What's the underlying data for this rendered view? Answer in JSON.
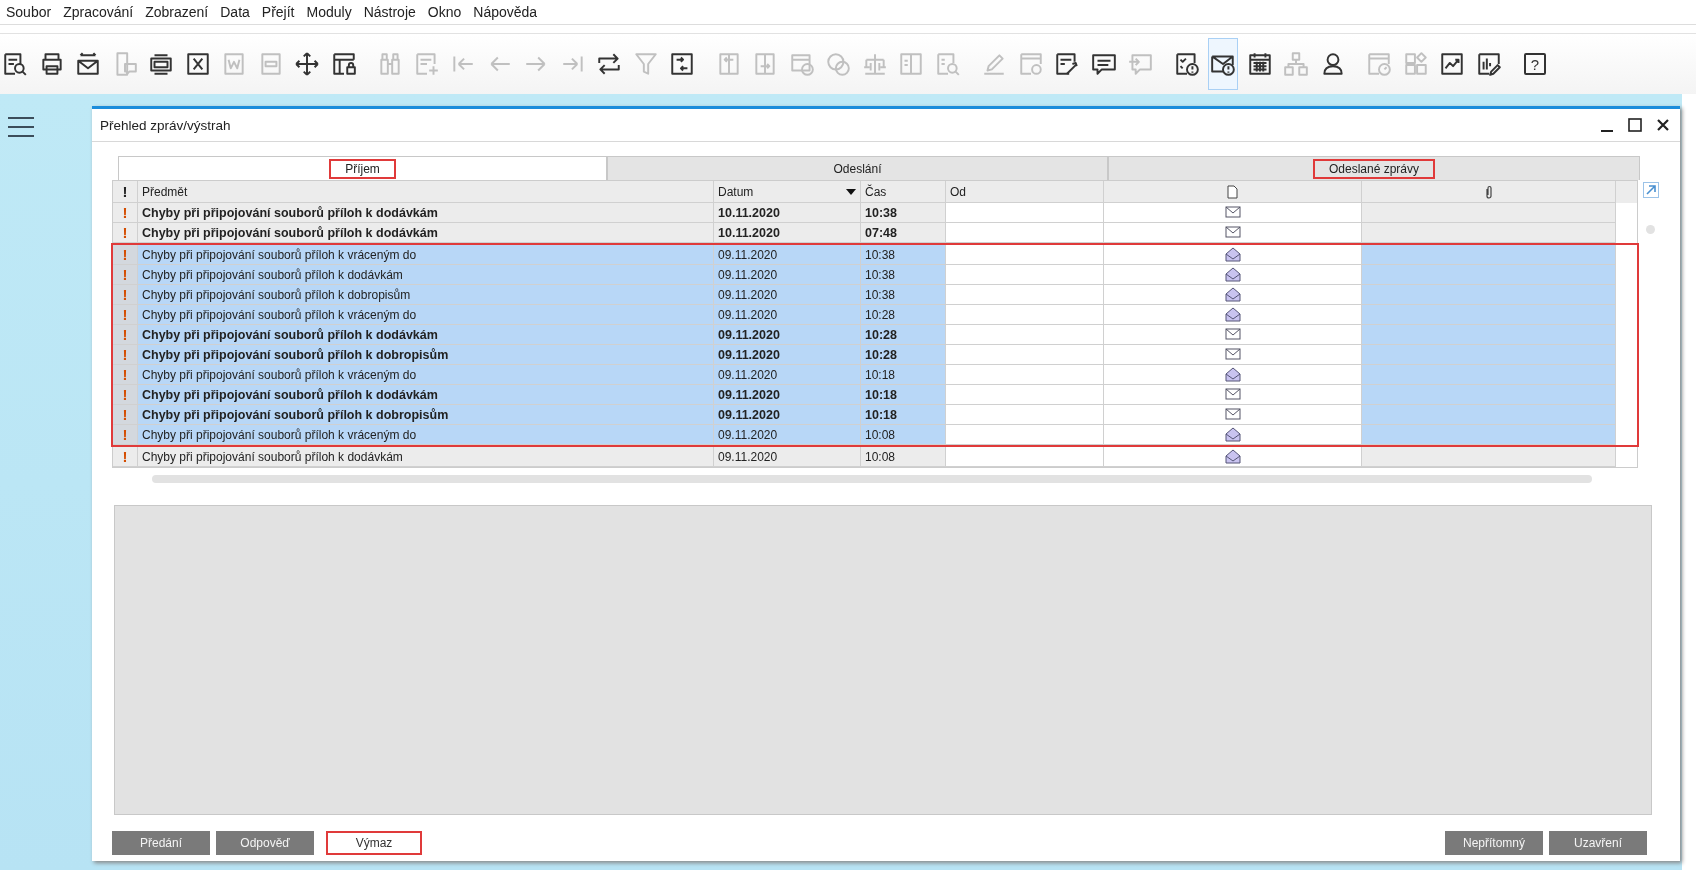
{
  "menu": [
    "Soubor",
    "Zpracování",
    "Zobrazení",
    "Data",
    "Přejít",
    "Moduly",
    "Nástroje",
    "Okno",
    "Nápověda"
  ],
  "toolbar": [
    {
      "disabled": false,
      "selected": false
    },
    {
      "disabled": false,
      "selected": false
    },
    {
      "disabled": false,
      "selected": false
    },
    {
      "disabled": true,
      "selected": false
    },
    {
      "disabled": false,
      "selected": false
    },
    {
      "disabled": false,
      "selected": false
    },
    {
      "disabled": true,
      "selected": false
    },
    {
      "disabled": true,
      "selected": false
    },
    {
      "disabled": false,
      "selected": false
    },
    {
      "disabled": false,
      "selected": false
    },
    {
      "disabled": true,
      "selected": false
    },
    {
      "disabled": true,
      "selected": false
    },
    {
      "disabled": true,
      "selected": false
    },
    {
      "disabled": true,
      "selected": false
    },
    {
      "disabled": true,
      "selected": false
    },
    {
      "disabled": true,
      "selected": false
    },
    {
      "disabled": false,
      "selected": false
    },
    {
      "disabled": true,
      "selected": false
    },
    {
      "disabled": false,
      "selected": false
    },
    {
      "disabled": true,
      "selected": false
    },
    {
      "disabled": true,
      "selected": false
    },
    {
      "disabled": true,
      "selected": false
    },
    {
      "disabled": true,
      "selected": false
    },
    {
      "disabled": true,
      "selected": false
    },
    {
      "disabled": true,
      "selected": false
    },
    {
      "disabled": true,
      "selected": false
    },
    {
      "disabled": true,
      "selected": false
    },
    {
      "disabled": true,
      "selected": false
    },
    {
      "disabled": false,
      "selected": false
    },
    {
      "disabled": false,
      "selected": false
    },
    {
      "disabled": true,
      "selected": false
    },
    {
      "disabled": false,
      "selected": false
    },
    {
      "disabled": false,
      "selected": true
    },
    {
      "disabled": false,
      "selected": false
    },
    {
      "disabled": true,
      "selected": false
    },
    {
      "disabled": false,
      "selected": false
    },
    {
      "disabled": true,
      "selected": false
    },
    {
      "disabled": true,
      "selected": false
    },
    {
      "disabled": false,
      "selected": false
    },
    {
      "disabled": false,
      "selected": false
    },
    {
      "disabled": false,
      "selected": false,
      "label": "?"
    }
  ],
  "window": {
    "title": "Přehled zpráv/výstrah"
  },
  "tabs": [
    {
      "label": "Příjem",
      "selected": true,
      "annotated": true
    },
    {
      "label": "Odeslání",
      "selected": false,
      "annotated": false
    },
    {
      "label": "Odeslané zprávy",
      "selected": false,
      "annotated": true
    }
  ],
  "table": {
    "columns": [
      {
        "label": "!",
        "sorted": false
      },
      {
        "label": "Předmět",
        "sorted": false
      },
      {
        "label": "Datum",
        "sorted": true
      },
      {
        "label": "Čas",
        "sorted": false
      },
      {
        "label": "Od",
        "sorted": false
      }
    ],
    "rows": [
      {
        "flag": "!",
        "subject": "Chyby při připojování souborů příloh k dodávkám",
        "date": "10.11.2020",
        "time": "10:38",
        "unread": true,
        "selected": false,
        "annotated": false
      },
      {
        "flag": "!",
        "subject": "Chyby při připojování souborů příloh k dodávkám",
        "date": "10.11.2020",
        "time": "07:48",
        "unread": true,
        "selected": false,
        "annotated": false
      },
      {
        "flag": "!",
        "subject": "Chyby při připojování souborů příloh k vráceným do",
        "date": "09.11.2020",
        "time": "10:38",
        "unread": false,
        "selected": true,
        "annotated": true
      },
      {
        "flag": "!",
        "subject": "Chyby při připojování souborů příloh k dodávkám",
        "date": "09.11.2020",
        "time": "10:38",
        "unread": false,
        "selected": true,
        "annotated": true
      },
      {
        "flag": "!",
        "subject": "Chyby při připojování souborů příloh k dobropisům",
        "date": "09.11.2020",
        "time": "10:38",
        "unread": false,
        "selected": true,
        "annotated": true
      },
      {
        "flag": "!",
        "subject": "Chyby při připojování souborů příloh k vráceným do",
        "date": "09.11.2020",
        "time": "10:28",
        "unread": false,
        "selected": true,
        "annotated": true
      },
      {
        "flag": "!",
        "subject": "Chyby při připojování souborů příloh k dodávkám",
        "date": "09.11.2020",
        "time": "10:28",
        "unread": true,
        "selected": true,
        "annotated": true
      },
      {
        "flag": "!",
        "subject": "Chyby při připojování souborů příloh k dobropisům",
        "date": "09.11.2020",
        "time": "10:28",
        "unread": true,
        "selected": true,
        "annotated": true
      },
      {
        "flag": "!",
        "subject": "Chyby při připojování souborů příloh k vráceným do",
        "date": "09.11.2020",
        "time": "10:18",
        "unread": false,
        "selected": true,
        "annotated": true
      },
      {
        "flag": "!",
        "subject": "Chyby při připojování souborů příloh k dodávkám",
        "date": "09.11.2020",
        "time": "10:18",
        "unread": true,
        "selected": true,
        "annotated": true
      },
      {
        "flag": "!",
        "subject": "Chyby při připojování souborů příloh k dobropisům",
        "date": "09.11.2020",
        "time": "10:18",
        "unread": true,
        "selected": true,
        "annotated": true
      },
      {
        "flag": "!",
        "subject": "Chyby při připojování souborů příloh k vráceným do",
        "date": "09.11.2020",
        "time": "10:08",
        "unread": false,
        "selected": true,
        "annotated": true
      },
      {
        "flag": "!",
        "subject": "Chyby při připojování souborů příloh k dodávkám",
        "date": "09.11.2020",
        "time": "10:08",
        "unread": false,
        "selected": false,
        "annotated": false
      }
    ]
  },
  "buttons_left": [
    {
      "label": "Předání",
      "annotated": false
    },
    {
      "label": "Odpověď",
      "annotated": false
    },
    {
      "label": "Výmaz",
      "annotated": true
    }
  ],
  "buttons_right": [
    {
      "label": "Nepřítomný",
      "annotated": false
    },
    {
      "label": "Uzavření",
      "annotated": false
    }
  ]
}
